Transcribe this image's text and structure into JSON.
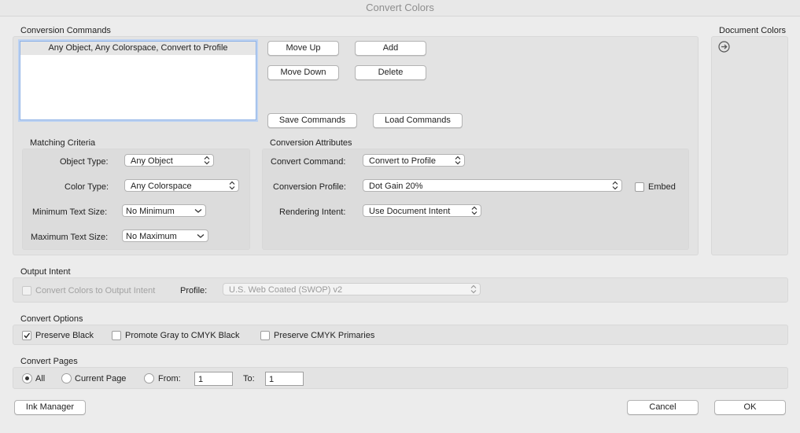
{
  "window": {
    "title": "Convert Colors"
  },
  "conversion_commands": {
    "heading": "Conversion Commands",
    "list": [
      "Any Object, Any Colorspace, Convert to Profile"
    ],
    "move_up": "Move Up",
    "add": "Add",
    "move_down": "Move Down",
    "delete": "Delete",
    "save_commands": "Save Commands",
    "load_commands": "Load Commands"
  },
  "document_colors": {
    "heading": "Document Colors",
    "icon": "arrow-right-circle-icon"
  },
  "matching_criteria": {
    "heading": "Matching Criteria",
    "object_type_label": "Object Type:",
    "object_type_value": "Any Object",
    "color_type_label": "Color Type:",
    "color_type_value": "Any Colorspace",
    "min_text_label": "Minimum Text Size:",
    "min_text_value": "No Minimum",
    "max_text_label": "Maximum Text Size:",
    "max_text_value": "No Maximum"
  },
  "conversion_attributes": {
    "heading": "Conversion Attributes",
    "convert_command_label": "Convert Command:",
    "convert_command_value": "Convert to Profile",
    "profile_label": "Conversion Profile:",
    "profile_value": "Dot Gain 20%",
    "embed_label": "Embed",
    "embed_checked": false,
    "intent_label": "Rendering Intent:",
    "intent_value": "Use Document Intent"
  },
  "output_intent": {
    "heading": "Output Intent",
    "convert_label": "Convert Colors to Output Intent",
    "convert_checked": false,
    "profile_label": "Profile:",
    "profile_value": "U.S. Web Coated (SWOP) v2"
  },
  "convert_options": {
    "heading": "Convert Options",
    "preserve_black": "Preserve Black",
    "preserve_black_checked": true,
    "promote_gray": "Promote Gray to CMYK Black",
    "promote_gray_checked": false,
    "preserve_cmyk": "Preserve CMYK Primaries",
    "preserve_cmyk_checked": false
  },
  "convert_pages": {
    "heading": "Convert Pages",
    "all": "All",
    "current_page": "Current Page",
    "from_label": "From:",
    "from_value": "1",
    "to_label": "To:",
    "to_value": "1",
    "selected": "All"
  },
  "footer": {
    "ink_manager": "Ink Manager",
    "cancel": "Cancel",
    "ok": "OK"
  }
}
